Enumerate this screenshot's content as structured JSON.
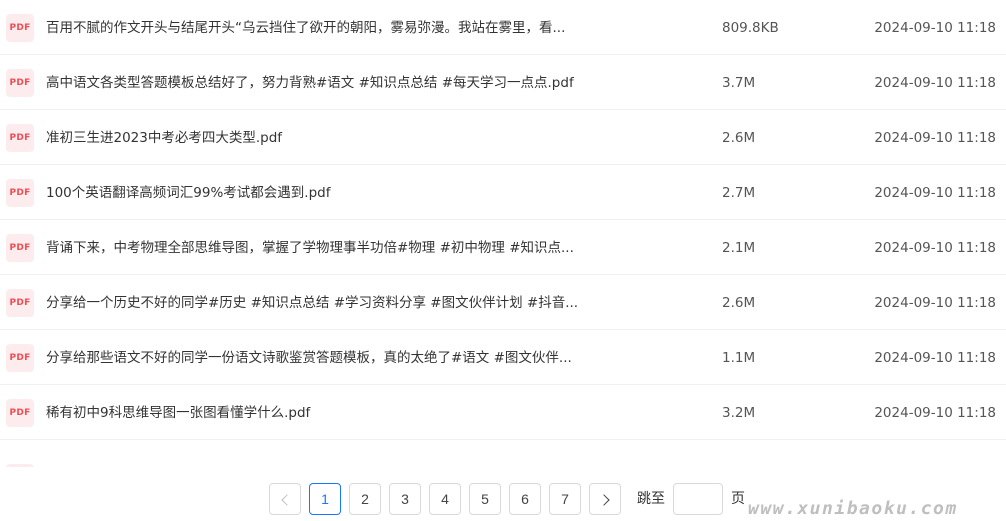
{
  "files": [
    {
      "icon": "PDF",
      "name": "百用不腻的作文开头与结尾开头“乌云挡住了欲开的朝阳，雾易弥漫。我站在雾里，看...",
      "size": "809.8KB",
      "date": "2024-09-10 11:18"
    },
    {
      "icon": "PDF",
      "name": "高中语文各类型答题模板总结好了，努力背熟#语文 #知识点总结 #每天学习一点点.pdf",
      "size": "3.7M",
      "date": "2024-09-10 11:18"
    },
    {
      "icon": "PDF",
      "name": "准初三生进2023中考必考四大类型.pdf",
      "size": "2.6M",
      "date": "2024-09-10 11:18"
    },
    {
      "icon": "PDF",
      "name": "100个英语翻译高频词汇99%考试都会遇到.pdf",
      "size": "2.7M",
      "date": "2024-09-10 11:18"
    },
    {
      "icon": "PDF",
      "name": "背诵下来，中考物理全部思维导图，掌握了学物理事半功倍#物理 #初中物理 #知识点...",
      "size": "2.1M",
      "date": "2024-09-10 11:18"
    },
    {
      "icon": "PDF",
      "name": "分享给一个历史不好的同学#历史 #知识点总结 #学习资料分享 #图文伙伴计划 #抖音...",
      "size": "2.6M",
      "date": "2024-09-10 11:18"
    },
    {
      "icon": "PDF",
      "name": "分享给那些语文不好的同学一份语文诗歌鉴赏答题模板，真的太绝了#语文 #图文伙伴...",
      "size": "1.1M",
      "date": "2024-09-10 11:18"
    },
    {
      "icon": "PDF",
      "name": "稀有初中9科思维导图一张图看懂学什么.pdf",
      "size": "3.2M",
      "date": "2024-09-10 11:18"
    }
  ],
  "pagination": {
    "pages": [
      "1",
      "2",
      "3",
      "4",
      "5",
      "6",
      "7"
    ],
    "current": "1",
    "jump_label": "跳至",
    "jump_value": "",
    "page_suffix": "页"
  },
  "watermark": "www.xunibaoku.com",
  "colors": {
    "pdf_icon_text": "#f04d55",
    "pdf_icon_bg": "#fdeced",
    "active_page": "#1677ff",
    "border": "#d9d9d9"
  }
}
